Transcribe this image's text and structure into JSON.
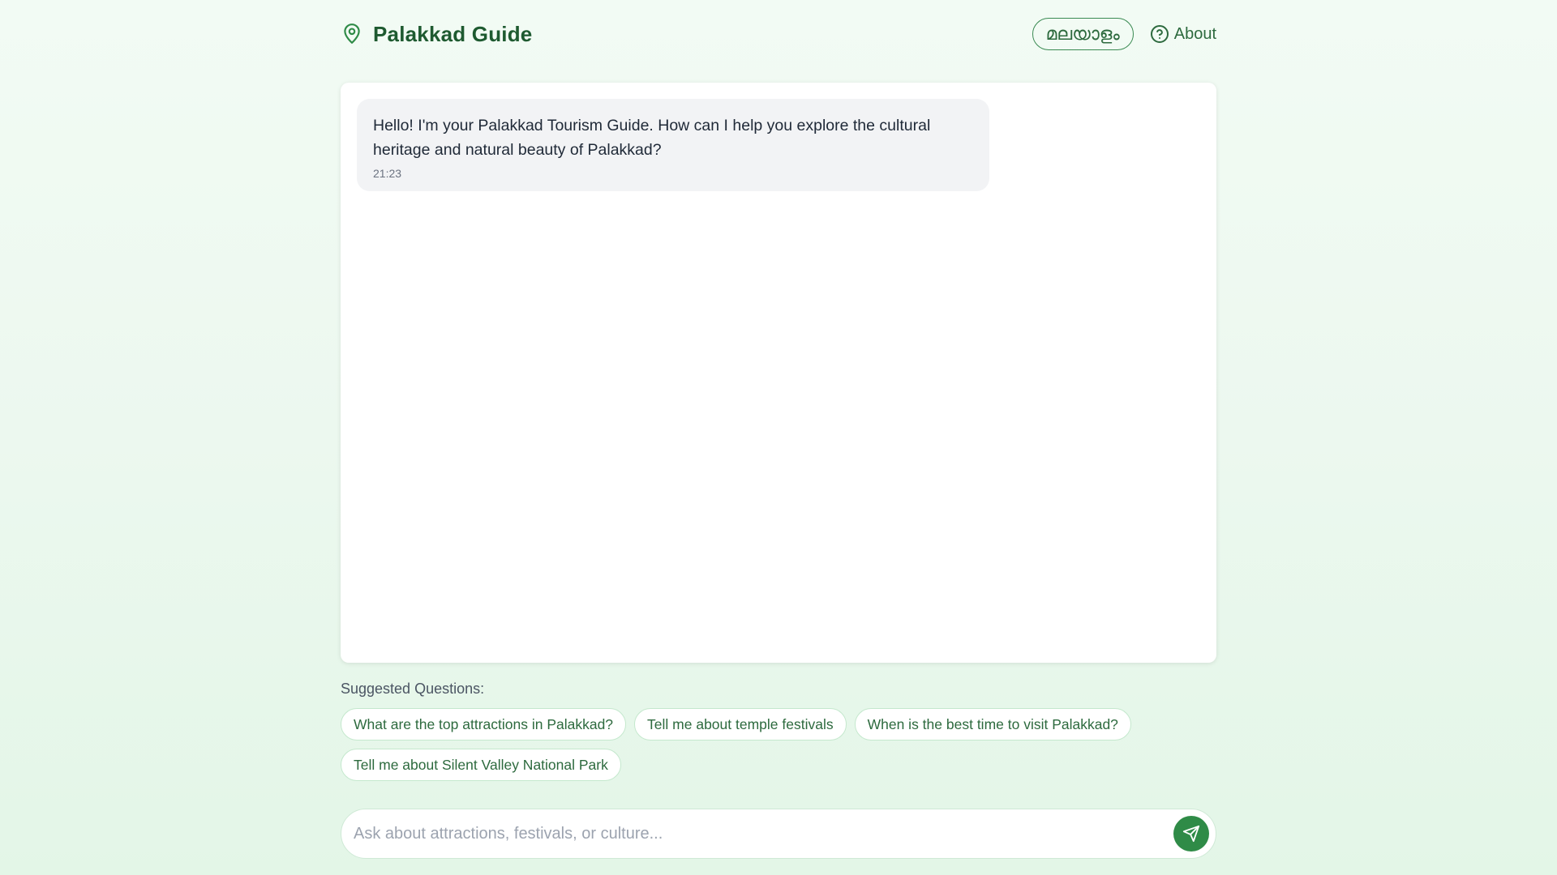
{
  "app": {
    "title": "Palakkad Guide"
  },
  "header": {
    "language_button": "മലയാളം",
    "about_label": "About"
  },
  "messages": [
    {
      "role": "assistant",
      "text": "Hello! I'm your Palakkad Tourism Guide. How can I help you explore the cultural heritage and natural beauty of Palakkad?",
      "time": "21:23"
    }
  ],
  "suggestions": {
    "label": "Suggested Questions:",
    "items": [
      "What are the top attractions in Palakkad?",
      "Tell me about temple festivals",
      "When is the best time to visit Palakkad?",
      "Tell me about Silent Valley National Park"
    ]
  },
  "input": {
    "value": "",
    "placeholder": "Ask about attractions, festivals, or culture..."
  },
  "icons": {
    "brand": "map-pin-icon",
    "about": "help-circle-icon",
    "send": "send-icon"
  },
  "colors": {
    "primary": "#2f8b47",
    "brand_text": "#1e5a30",
    "chip_border": "#c4e8cd",
    "background": "#ecf8ef"
  }
}
